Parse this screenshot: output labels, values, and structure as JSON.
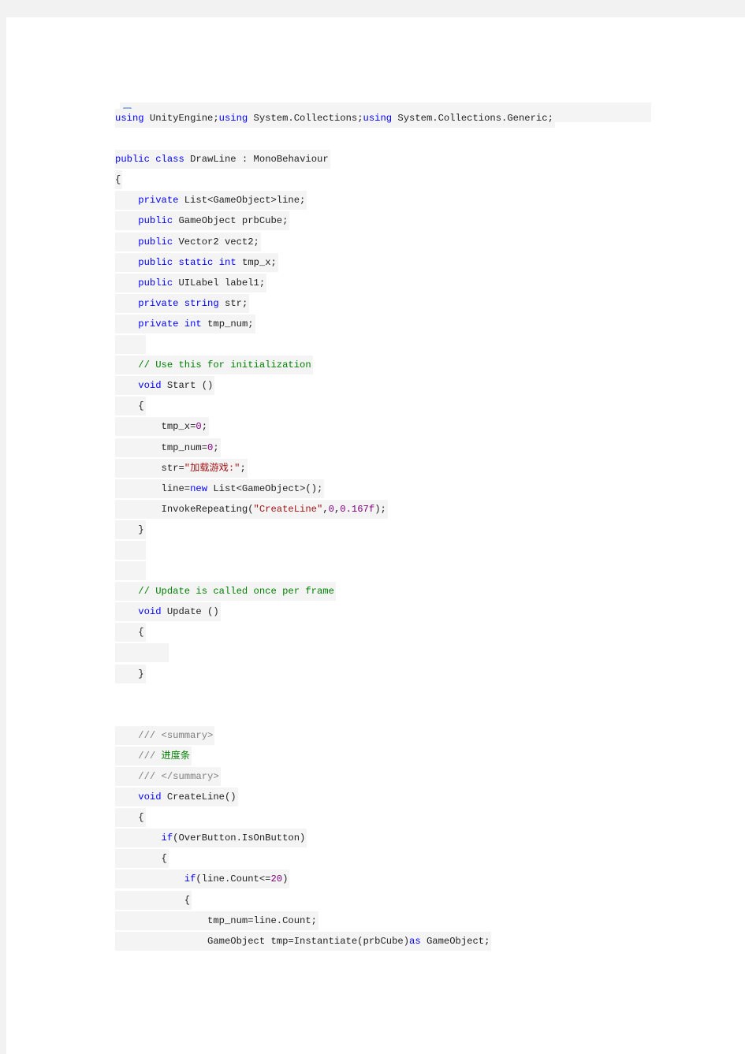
{
  "toolbar": {
    "icon": "copy-code-icon"
  },
  "colors": {
    "keyword": "#0000ff",
    "comment": "#008000",
    "string": "#a31515",
    "number": "#800080",
    "doc": "#808080",
    "line_bg": "#f4f4f4"
  },
  "code_lines": [
    {
      "indent": 0,
      "tokens": [
        [
          "kw",
          "using"
        ],
        [
          "t",
          " UnityEngine;"
        ],
        [
          "kw",
          "using"
        ],
        [
          "t",
          " System.Collections;"
        ],
        [
          "kw",
          "using"
        ],
        [
          "t",
          " System.Collections.Generic;"
        ]
      ]
    },
    {
      "indent": 0,
      "nobg": true,
      "tokens": []
    },
    {
      "indent": 0,
      "tokens": [
        [
          "kw",
          "public"
        ],
        [
          "t",
          " "
        ],
        [
          "kw",
          "class"
        ],
        [
          "t",
          " DrawLine : MonoBehaviour"
        ]
      ]
    },
    {
      "indent": 0,
      "tokens": [
        [
          "t",
          "{"
        ]
      ]
    },
    {
      "indent": 1,
      "tokens": [
        [
          "kw",
          "private"
        ],
        [
          "t",
          " List<GameObject>line;"
        ]
      ]
    },
    {
      "indent": 1,
      "tokens": [
        [
          "kw",
          "public"
        ],
        [
          "t",
          " GameObject prbCube;"
        ]
      ]
    },
    {
      "indent": 1,
      "tokens": [
        [
          "kw",
          "public"
        ],
        [
          "t",
          " Vector2 vect2;"
        ]
      ]
    },
    {
      "indent": 1,
      "tokens": [
        [
          "kw",
          "public"
        ],
        [
          "t",
          " "
        ],
        [
          "kw",
          "static"
        ],
        [
          "t",
          " "
        ],
        [
          "kw",
          "int"
        ],
        [
          "t",
          " tmp_x;"
        ]
      ]
    },
    {
      "indent": 1,
      "tokens": [
        [
          "kw",
          "public"
        ],
        [
          "t",
          " UILabel label1;"
        ]
      ]
    },
    {
      "indent": 1,
      "tokens": [
        [
          "kw",
          "private"
        ],
        [
          "t",
          " "
        ],
        [
          "kw",
          "string"
        ],
        [
          "t",
          " str;"
        ]
      ]
    },
    {
      "indent": 1,
      "tokens": [
        [
          "kw",
          "private"
        ],
        [
          "t",
          " "
        ],
        [
          "kw",
          "int"
        ],
        [
          "t",
          " tmp_num;"
        ]
      ]
    },
    {
      "indent": 1,
      "tokens": []
    },
    {
      "indent": 1,
      "tokens": [
        [
          "cm",
          "// Use this for initialization"
        ]
      ]
    },
    {
      "indent": 1,
      "tokens": [
        [
          "kw",
          "void"
        ],
        [
          "t",
          " Start ()"
        ]
      ]
    },
    {
      "indent": 1,
      "tokens": [
        [
          "t",
          "{"
        ]
      ]
    },
    {
      "indent": 2,
      "tokens": [
        [
          "t",
          "tmp_x="
        ],
        [
          "num",
          "0"
        ],
        [
          "t",
          ";"
        ]
      ]
    },
    {
      "indent": 2,
      "tokens": [
        [
          "t",
          "tmp_num="
        ],
        [
          "num",
          "0"
        ],
        [
          "t",
          ";"
        ]
      ]
    },
    {
      "indent": 2,
      "tokens": [
        [
          "t",
          "str="
        ],
        [
          "str",
          "\"加载游戏:\""
        ],
        [
          "t",
          ";"
        ]
      ]
    },
    {
      "indent": 2,
      "tokens": [
        [
          "t",
          "line="
        ],
        [
          "kw",
          "new"
        ],
        [
          "t",
          " List<GameObject>();"
        ]
      ]
    },
    {
      "indent": 2,
      "tokens": [
        [
          "t",
          "InvokeRepeating("
        ],
        [
          "str",
          "\"CreateLine\""
        ],
        [
          "t",
          ","
        ],
        [
          "num",
          "0"
        ],
        [
          "t",
          ","
        ],
        [
          "num",
          "0.167f"
        ],
        [
          "t",
          ");"
        ]
      ]
    },
    {
      "indent": 1,
      "tokens": [
        [
          "t",
          "}"
        ]
      ]
    },
    {
      "indent": 1,
      "tokens": []
    },
    {
      "indent": 1,
      "tokens": []
    },
    {
      "indent": 1,
      "tokens": [
        [
          "cm",
          "// Update is called once per frame"
        ]
      ]
    },
    {
      "indent": 1,
      "tokens": [
        [
          "kw",
          "void"
        ],
        [
          "t",
          " Update ()"
        ]
      ]
    },
    {
      "indent": 1,
      "tokens": [
        [
          "t",
          "{"
        ]
      ]
    },
    {
      "indent": 2,
      "tokens": []
    },
    {
      "indent": 1,
      "tokens": [
        [
          "t",
          "}"
        ]
      ]
    },
    {
      "indent": 0,
      "nobg": true,
      "tokens": []
    },
    {
      "indent": 0,
      "nobg": true,
      "tokens": []
    },
    {
      "indent": 1,
      "tokens": [
        [
          "doc",
          "/// <summary>"
        ]
      ]
    },
    {
      "indent": 1,
      "tokens": [
        [
          "doc",
          "/// "
        ],
        [
          "cm",
          "进度条"
        ]
      ]
    },
    {
      "indent": 1,
      "tokens": [
        [
          "doc",
          "/// </summary>"
        ]
      ]
    },
    {
      "indent": 1,
      "tokens": [
        [
          "kw",
          "void"
        ],
        [
          "t",
          " CreateLine()"
        ]
      ]
    },
    {
      "indent": 1,
      "tokens": [
        [
          "t",
          "{"
        ]
      ]
    },
    {
      "indent": 2,
      "tokens": [
        [
          "kw",
          "if"
        ],
        [
          "t",
          "(OverButton.IsOnButton)"
        ]
      ]
    },
    {
      "indent": 2,
      "tokens": [
        [
          "t",
          "{"
        ]
      ]
    },
    {
      "indent": 3,
      "tokens": [
        [
          "kw",
          "if"
        ],
        [
          "t",
          "(line.Count<="
        ],
        [
          "num",
          "20"
        ],
        [
          "t",
          ")"
        ]
      ]
    },
    {
      "indent": 3,
      "tokens": [
        [
          "t",
          "{"
        ]
      ]
    },
    {
      "indent": 4,
      "tokens": [
        [
          "t",
          "tmp_num=line.Count;"
        ]
      ]
    },
    {
      "indent": 4,
      "tokens": [
        [
          "t",
          "GameObject tmp=Instantiate(prbCube)"
        ],
        [
          "kw",
          "as"
        ],
        [
          "t",
          " GameObject;"
        ]
      ]
    }
  ]
}
